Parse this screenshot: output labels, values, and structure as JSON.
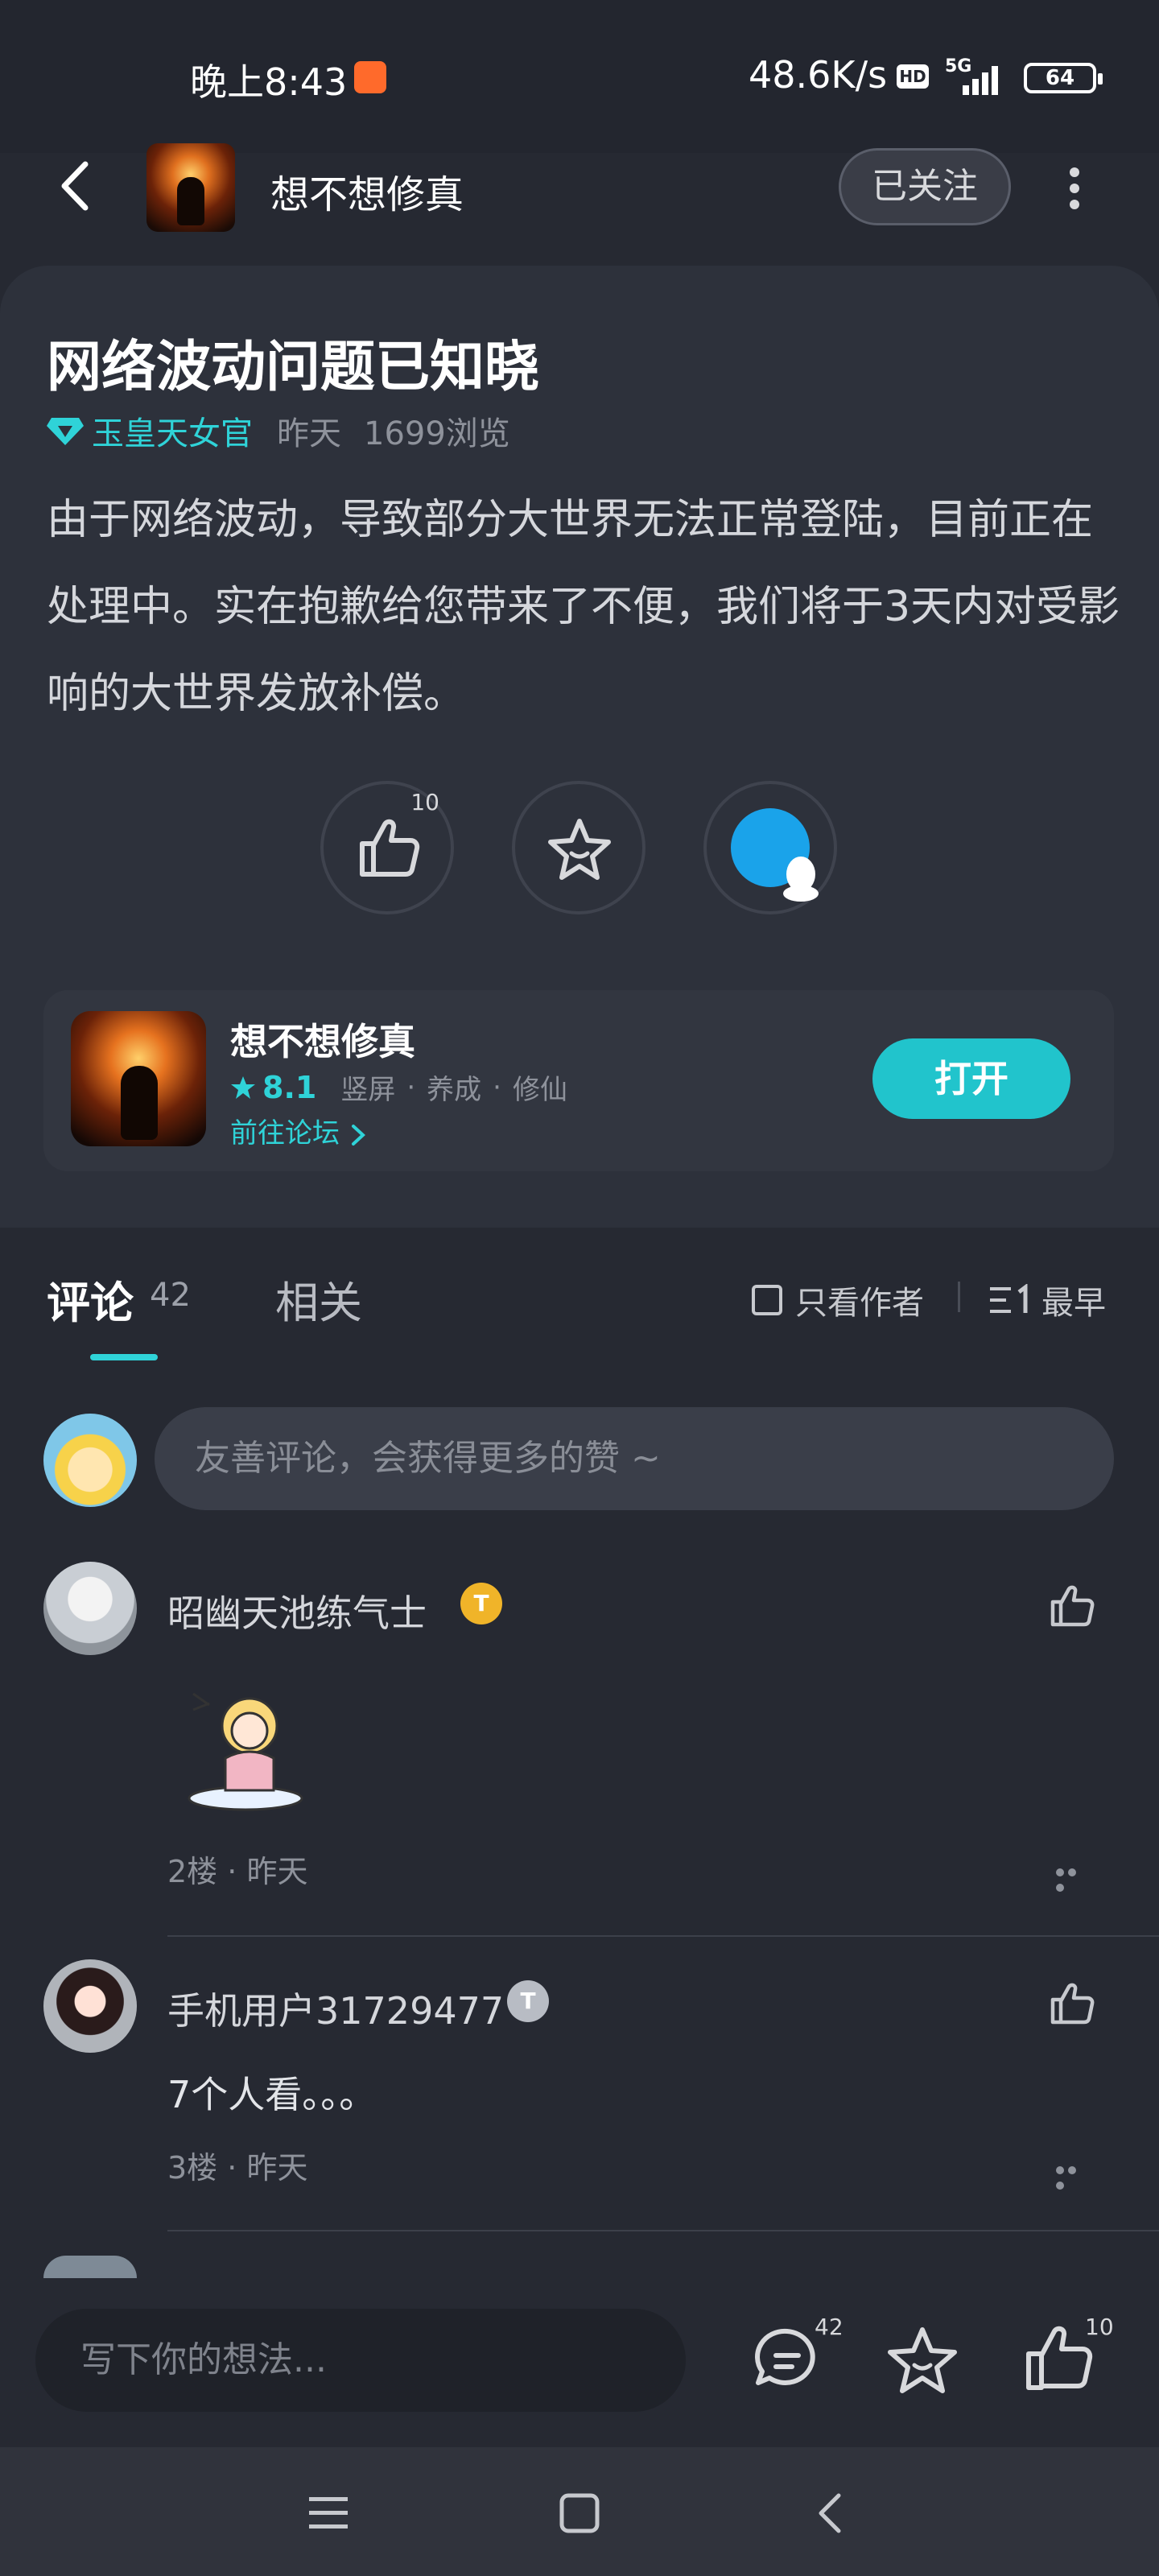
{
  "status_bar": {
    "time": "晚上8:43",
    "speed": "48.6K/s",
    "hd": "HD",
    "network": "5G",
    "battery": "64"
  },
  "header": {
    "title": "想不想修真",
    "follow_label": "已关注"
  },
  "post": {
    "title": "网络波动问题已知晓",
    "author": "玉皇天女官",
    "time": "昨天",
    "views": "1699浏览",
    "body": "由于网络波动，导致部分大世界无法正常登陆，目前正在处理中。实在抱歉给您带来了不便，我们将于3天内对受影响的大世界发放补偿。",
    "like_count": "10"
  },
  "game": {
    "name": "想不想修真",
    "rating": "8.1",
    "tags": [
      "竖屏",
      "养成",
      "修仙"
    ],
    "forum_link": "前往论坛",
    "open_label": "打开"
  },
  "tabs": {
    "comments_label": "评论",
    "comments_count": "42",
    "related_label": "相关",
    "author_only_label": "只看作者",
    "sort_label": "最早"
  },
  "comment_input": {
    "placeholder": "友善评论，会获得更多的赞 ~"
  },
  "comments": [
    {
      "name": "昭幽天池练气士",
      "badge": "T",
      "floor": "2楼",
      "time": "昨天"
    },
    {
      "name": "手机用户31729477",
      "badge": "T",
      "text": "7个人看。。。",
      "floor": "3楼",
      "time": "昨天"
    }
  ],
  "bottom_bar": {
    "placeholder": "写下你的想法...",
    "comment_count": "42",
    "like_count": "10"
  },
  "colors": {
    "accent": "#2fd3d8",
    "background": "#262932",
    "card": "#2d313b",
    "qq_blue": "#1aa3ea"
  }
}
